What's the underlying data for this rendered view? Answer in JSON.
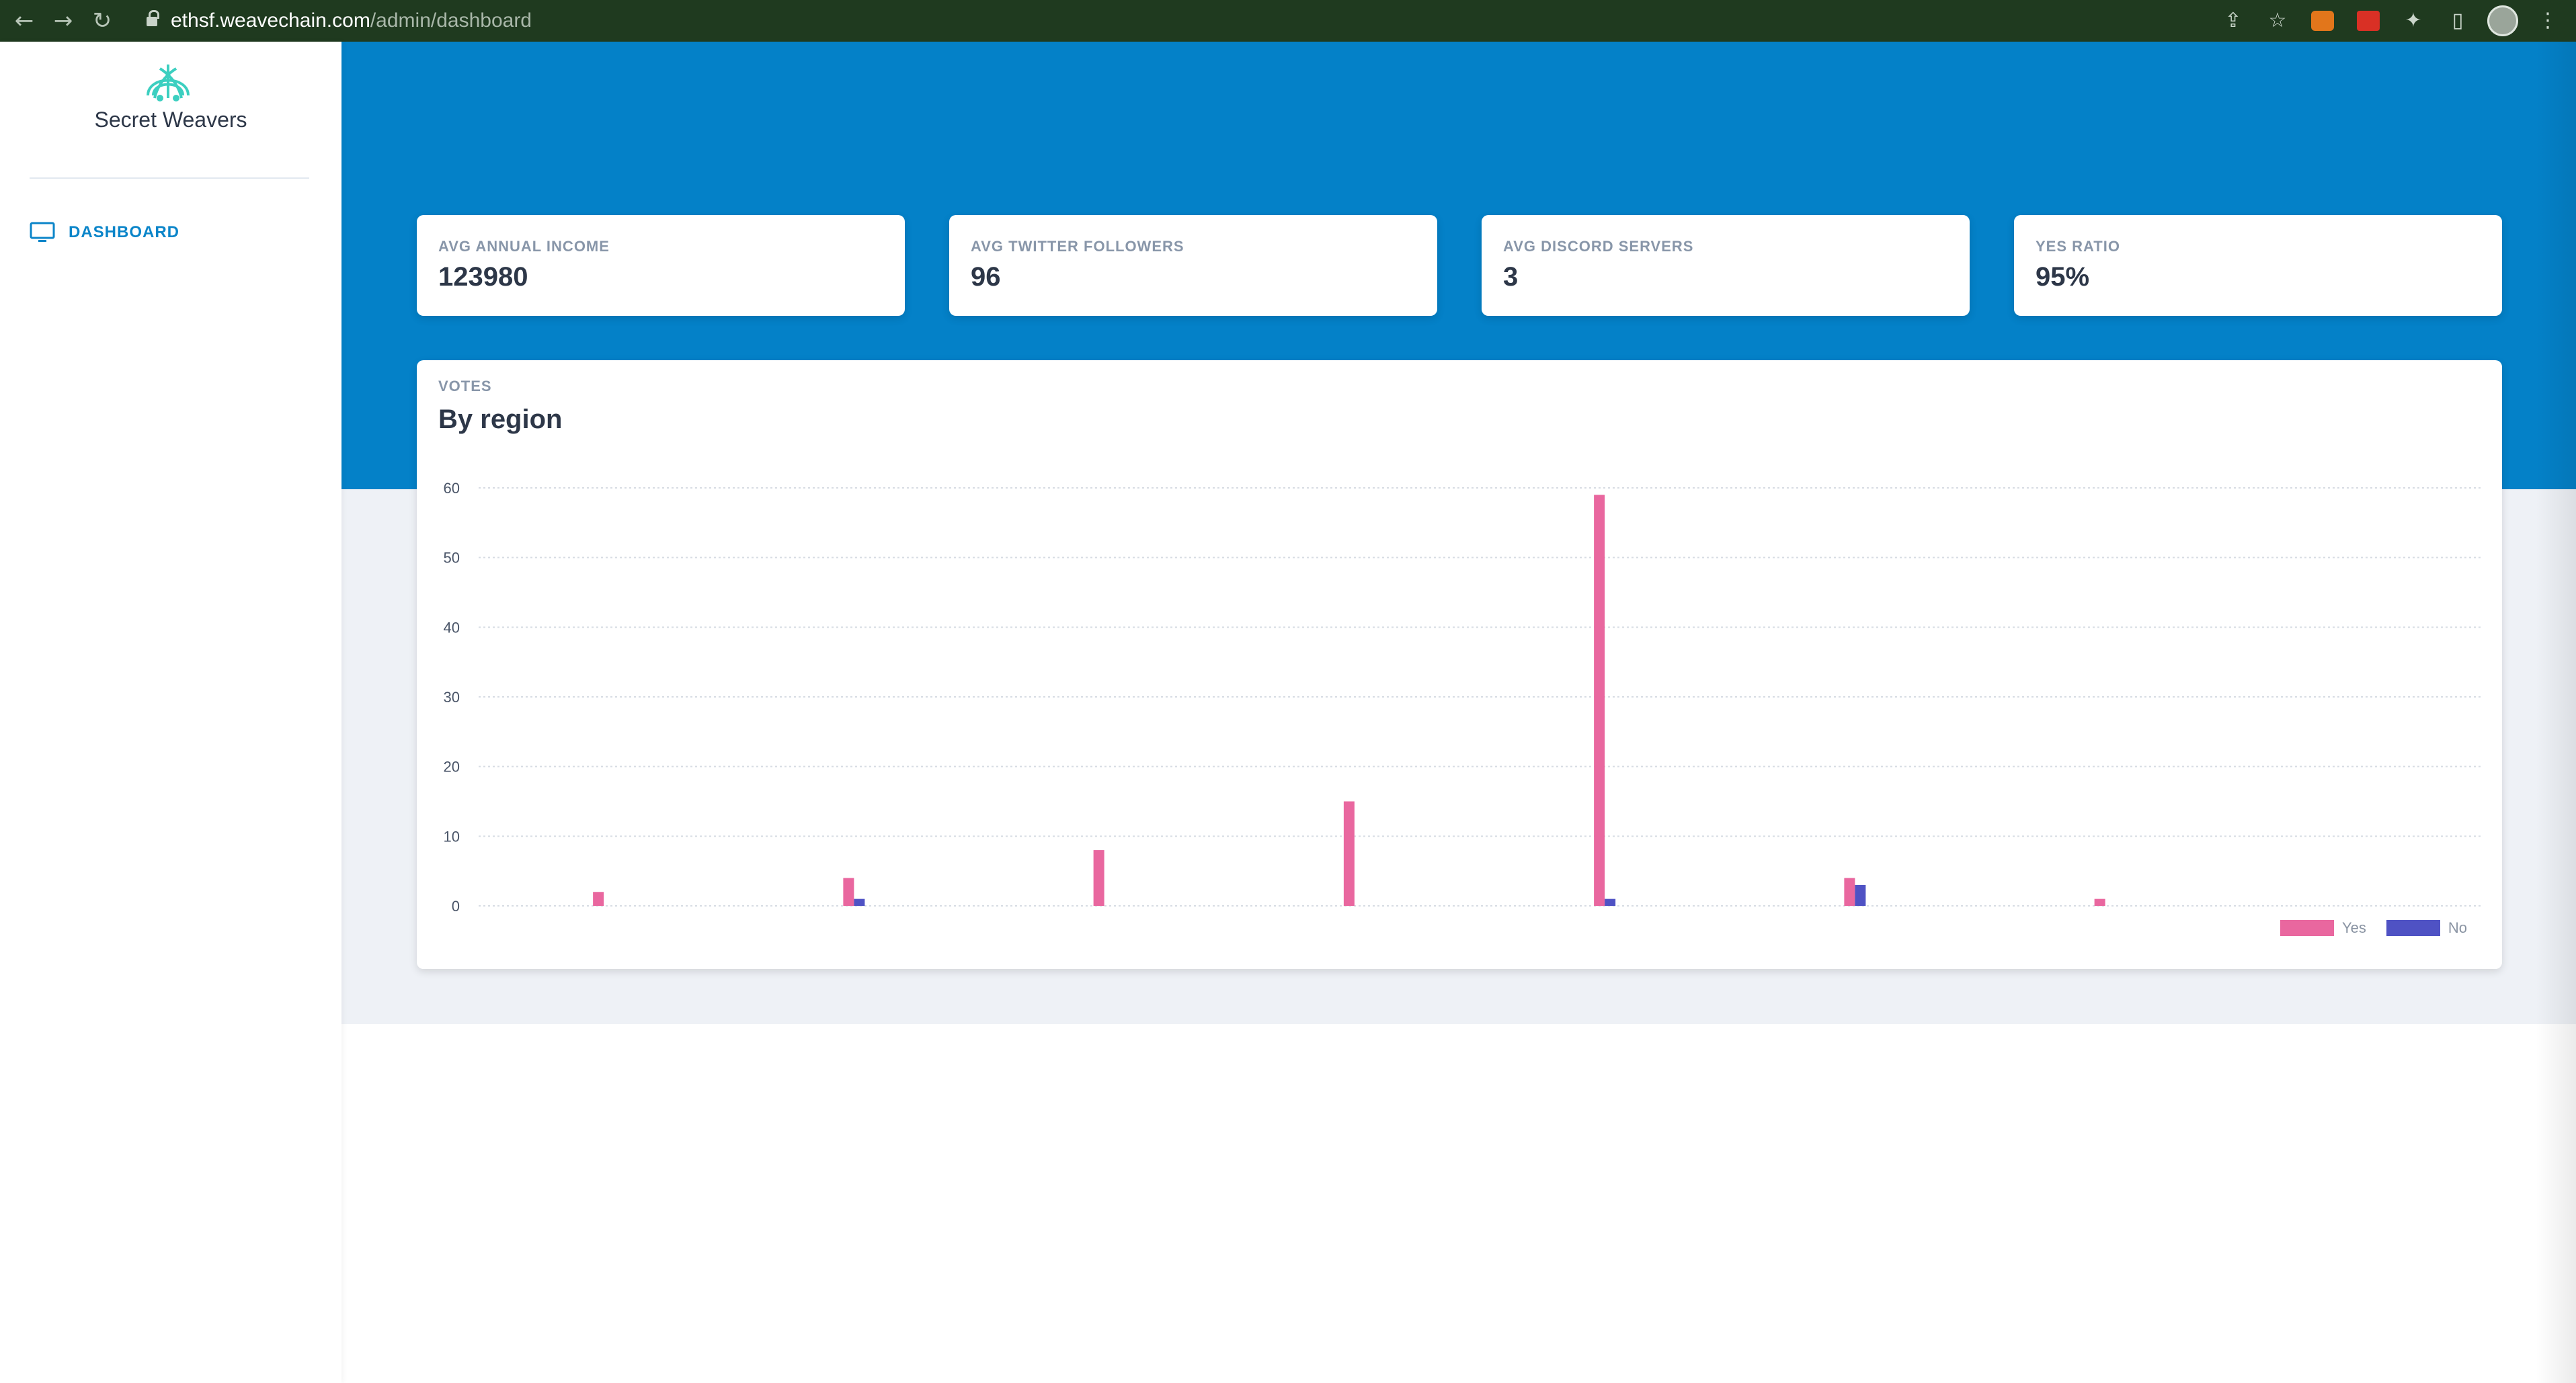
{
  "browser": {
    "url_host": "ethsf.weavechain.com",
    "url_path": "/admin/dashboard",
    "back_icon": "arrow-left-icon",
    "forward_icon": "arrow-right-icon",
    "reload_icon": "reload-icon"
  },
  "sidebar": {
    "brand_name": "Secret Weavers",
    "items": [
      {
        "label": "DASHBOARD",
        "icon": "monitor-icon",
        "active": true
      }
    ]
  },
  "colors": {
    "accent": "#0481c8",
    "yes": "#e9679f",
    "no": "#4f52c4"
  },
  "stats": [
    {
      "label": "AVG ANNUAL INCOME",
      "value": "123980"
    },
    {
      "label": "AVG TWITTER FOLLOWERS",
      "value": "96"
    },
    {
      "label": "AVG DISCORD SERVERS",
      "value": "3"
    },
    {
      "label": "YES RATIO",
      "value": "95%"
    }
  ],
  "chart_card": {
    "eyebrow": "VOTES",
    "title": "By region"
  },
  "chart_data": {
    "type": "bar",
    "categories": [
      "",
      "",
      "",
      "",
      "",
      "",
      "",
      ""
    ],
    "series": [
      {
        "name": "Yes",
        "values": [
          2,
          4,
          8,
          15,
          59,
          4,
          1,
          0
        ]
      },
      {
        "name": "No",
        "values": [
          0,
          1,
          0,
          0,
          1,
          3,
          0,
          0
        ]
      }
    ],
    "ylim": [
      0,
      60
    ],
    "yticks": [
      "0",
      "10",
      "20",
      "30",
      "40",
      "50",
      "60"
    ],
    "grid": true,
    "legend": "bottom-right"
  }
}
